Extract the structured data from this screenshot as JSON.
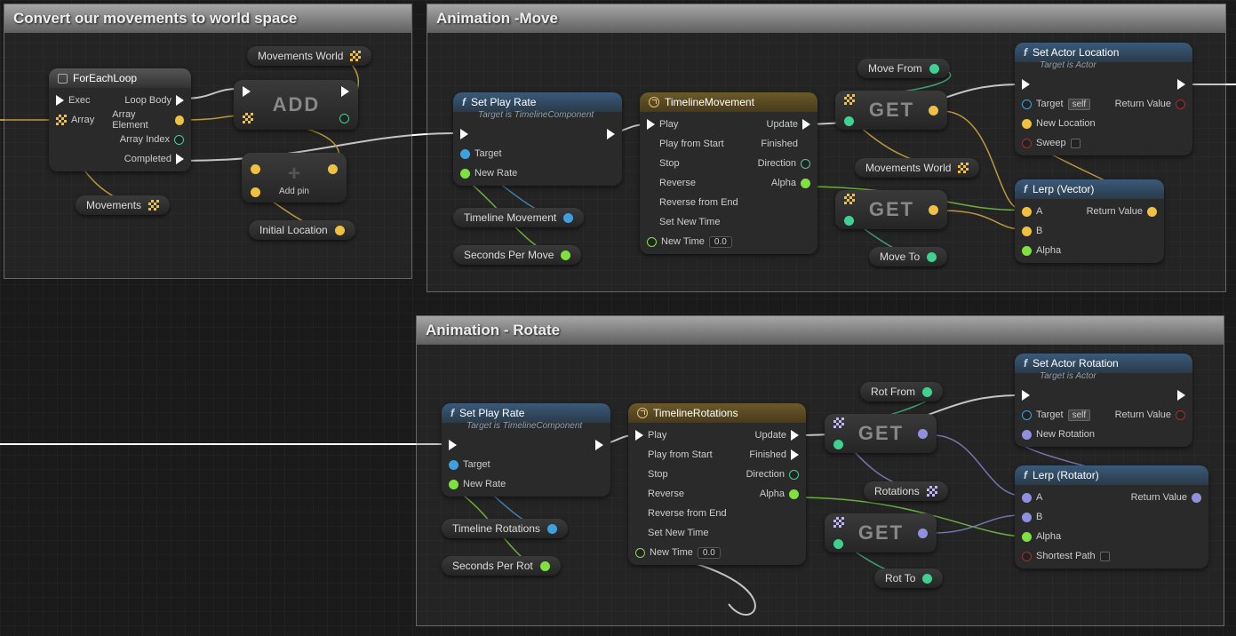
{
  "comments": {
    "convert": {
      "title": "Convert our movements to world space"
    },
    "move": {
      "title": "Animation -Move"
    },
    "rotate": {
      "title": "Animation - Rotate"
    }
  },
  "nodes": {
    "foreach": {
      "title": "ForEachLoop",
      "pins": {
        "exec": "Exec",
        "array": "Array",
        "loopbody": "Loop Body",
        "elem": "Array Element",
        "idx": "Array Index",
        "done": "Completed"
      }
    },
    "add": {
      "label": "ADD",
      "addpin": "Add pin"
    },
    "plus": {
      "label": "+"
    },
    "setplay1": {
      "title": "Set Play Rate",
      "sub": "Target is TimelineComponent",
      "target": "Target",
      "rate": "New Rate"
    },
    "setplay2": {
      "title": "Set Play Rate",
      "sub": "Target is TimelineComponent",
      "target": "Target",
      "rate": "New Rate"
    },
    "tlmove": {
      "title": "TimelineMovement",
      "play": "Play",
      "pfs": "Play from Start",
      "stop": "Stop",
      "rev": "Reverse",
      "rfe": "Reverse from End",
      "snt": "Set New Time",
      "nt": "New Time",
      "ntval": "0.0",
      "upd": "Update",
      "fin": "Finished",
      "dir": "Direction",
      "alpha": "Alpha"
    },
    "tlrot": {
      "title": "TimelineRotations",
      "play": "Play",
      "pfs": "Play from Start",
      "stop": "Stop",
      "rev": "Reverse",
      "rfe": "Reverse from End",
      "snt": "Set New Time",
      "nt": "New Time",
      "ntval": "0.0",
      "upd": "Update",
      "fin": "Finished",
      "dir": "Direction",
      "alpha": "Alpha"
    },
    "get1": {
      "label": "GET"
    },
    "get2": {
      "label": "GET"
    },
    "get3": {
      "label": "GET"
    },
    "get4": {
      "label": "GET"
    },
    "setloc": {
      "title": "Set Actor Location",
      "sub": "Target is Actor",
      "target": "Target",
      "self": "self",
      "nl": "New Location",
      "sweep": "Sweep",
      "rv": "Return Value"
    },
    "setrot": {
      "title": "Set Actor Rotation",
      "sub": "Target is Actor",
      "target": "Target",
      "self": "self",
      "nr": "New Rotation",
      "rv": "Return Value"
    },
    "lerpv": {
      "title": "Lerp (Vector)",
      "a": "A",
      "b": "B",
      "alpha": "Alpha",
      "rv": "Return Value"
    },
    "lerpr": {
      "title": "Lerp (Rotator)",
      "a": "A",
      "b": "B",
      "alpha": "Alpha",
      "sp": "Shortest Path",
      "rv": "Return Value"
    }
  },
  "vars": {
    "movworld": "Movements World",
    "movements": "Movements",
    "initloc": "Initial Location",
    "tlmov": "Timeline Movement",
    "spm": "Seconds Per Move",
    "movefrom": "Move From",
    "moveto": "Move To",
    "movworld2": "Movements World",
    "tlrot": "Timeline Rotations",
    "spr": "Seconds Per Rot",
    "rotfrom": "Rot From",
    "rotto": "Rot To",
    "rotations": "Rotations"
  }
}
